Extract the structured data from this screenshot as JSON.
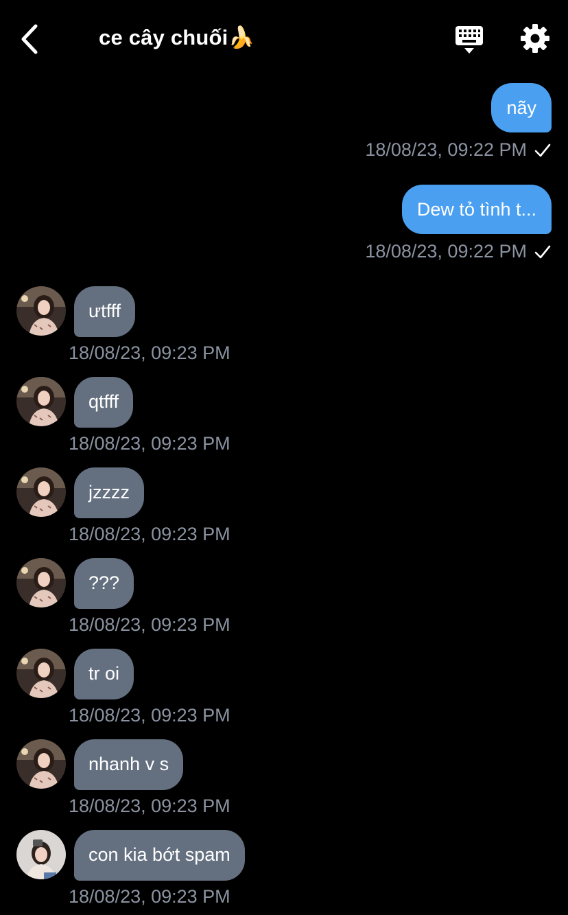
{
  "header": {
    "title": "ce cây chuối🍌",
    "back_icon": "chevron-left-icon",
    "keyboard_icon": "keyboard-hide-icon",
    "settings_icon": "gear-icon"
  },
  "colors": {
    "outgoing_bubble": "#4a9ff0",
    "incoming_bubble": "#647080",
    "timestamp": "#8b93a1",
    "background": "#000000"
  },
  "messages": [
    {
      "direction": "out",
      "text": "nãy",
      "time": "18/08/23, 09:22 PM",
      "status_icon": "check-icon"
    },
    {
      "direction": "out",
      "text": "Dew tỏ tình t...",
      "time": "18/08/23, 09:22 PM",
      "status_icon": "check-icon"
    },
    {
      "direction": "in",
      "text": "ưtfff",
      "time": "18/08/23, 09:23 PM"
    },
    {
      "direction": "in",
      "text": "qtfff",
      "time": "18/08/23, 09:23 PM"
    },
    {
      "direction": "in",
      "text": "jzzzz",
      "time": "18/08/23, 09:23 PM"
    },
    {
      "direction": "in",
      "text": "???",
      "time": "18/08/23, 09:23 PM"
    },
    {
      "direction": "in",
      "text": "tr oi",
      "time": "18/08/23, 09:23 PM"
    },
    {
      "direction": "in",
      "text": "nhanh v s",
      "time": "18/08/23, 09:23 PM"
    },
    {
      "direction": "in",
      "text": "con kia bớt spam",
      "time": "18/08/23, 09:23 PM"
    }
  ]
}
